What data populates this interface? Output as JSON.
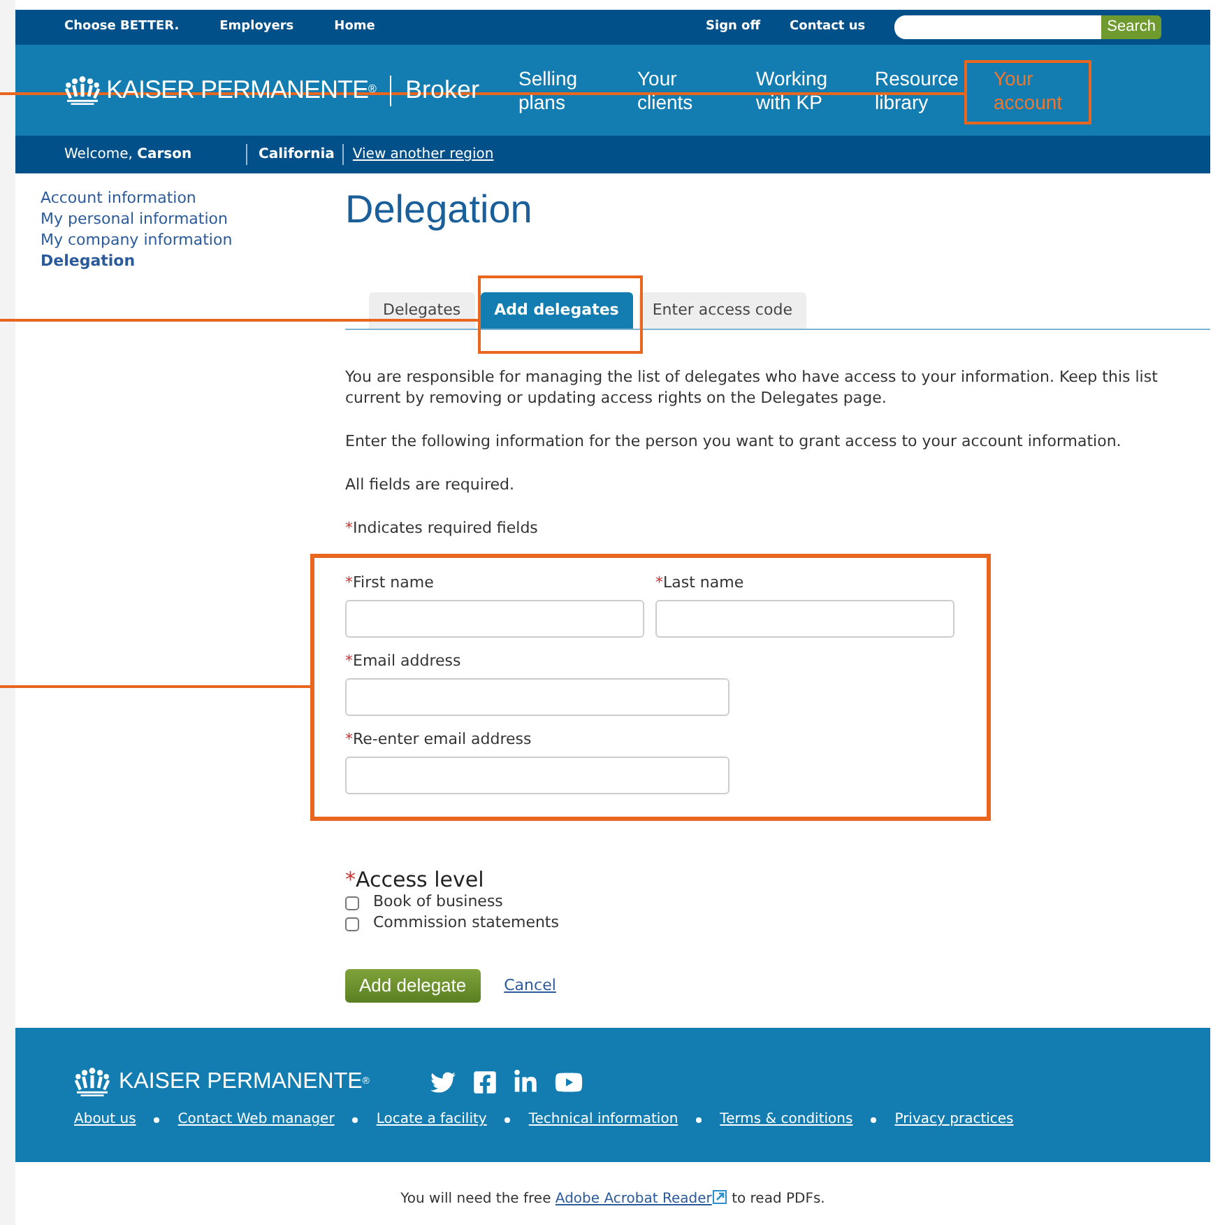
{
  "top_bar": {
    "left_links": [
      "Choose BETTER.",
      "Employers",
      "Home"
    ],
    "right_links": [
      "Sign off",
      "Contact us"
    ],
    "search": {
      "button": "Search"
    }
  },
  "header": {
    "logo": "KAISER PERMANENTE$^{®}$",
    "product": "Broker",
    "nav": [
      {
        "label": "Selling plans",
        "selected": false
      },
      {
        "label": "Your clients",
        "selected": false
      },
      {
        "label": "Working with KP",
        "selected": false
      },
      {
        "label": "Resource library",
        "selected": false
      },
      {
        "label": "Your account",
        "selected": true
      }
    ]
  },
  "welcome_bar": {
    "greeting": "Welcome, **Carson**",
    "region": "California",
    "link": "View another region"
  },
  "sidebar": {
    "items": [
      {
        "label": "Account information",
        "selected": false
      },
      {
        "label": "My personal information",
        "selected": false
      },
      {
        "label": "My company information",
        "selected": false
      },
      {
        "label": "Delegation",
        "selected": true
      }
    ]
  },
  "page_title": "Delegation",
  "tabs": [
    {
      "label": "Delegates",
      "selected": false
    },
    {
      "label": "Add delegates",
      "selected": true
    },
    {
      "label": "Enter access code",
      "selected": false
    }
  ],
  "intro": [
    "You are responsible for managing the list of delegates who have access to your information. Keep this list current by removing or updating access rights on the Delegates page.",
    "Enter the following information for the person you want to grant access to your account information.",
    "All fields are required."
  ],
  "required_note": {
    "mark": "*",
    "text": "Indicates required fields"
  },
  "fields": [
    {
      "mark": "*",
      "label": "First name",
      "kind": "short"
    },
    {
      "mark": "*",
      "label": "Last name",
      "kind": "short"
    },
    {
      "mark": "*",
      "label": "Email address",
      "kind": "long"
    },
    {
      "mark": "*",
      "label": "Re-enter email address",
      "kind": "long"
    }
  ],
  "access_level": {
    "mark": "*",
    "title": "Access level",
    "options": [
      {
        "label": "Book of business",
        "checked": false
      },
      {
        "label": "Commission statements",
        "checked": false
      }
    ]
  },
  "buttons": {
    "submit": "Add delegate",
    "cancel": "Cancel"
  },
  "footer": {
    "logo": "KAISER PERMANENTE$^{®}$",
    "links": [
      "About us",
      "Contact Web manager",
      "Locate a facility",
      "Technical information",
      "Terms & conditions",
      "Privacy practices"
    ]
  },
  "pdf_note": {
    "before": "You will need the free",
    "link": "Adobe Acrobat Reader",
    "after": "to read PDFs."
  }
}
